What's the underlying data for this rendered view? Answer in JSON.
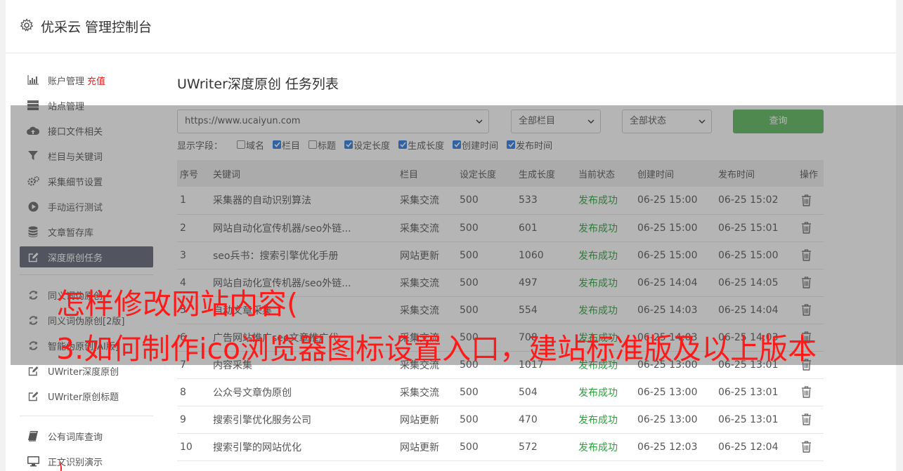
{
  "header": {
    "title": "优采云 管理控制台"
  },
  "sidebar": {
    "recharge": "充值",
    "items": [
      {
        "label": "账户管理",
        "icon": "bar-chart-icon"
      },
      {
        "label": "站点管理",
        "icon": "server-icon"
      },
      {
        "label": "接口文件相关",
        "icon": "cloud-upload-icon"
      },
      {
        "label": "栏目与关键词",
        "icon": "filter-icon"
      },
      {
        "label": "采集细节设置",
        "icon": "gears-icon"
      },
      {
        "label": "手动运行测试",
        "icon": "play-circle-icon"
      },
      {
        "label": "文章暂存库",
        "icon": "database-icon"
      },
      {
        "label": "深度原创任务",
        "icon": "edit-icon"
      },
      {
        "label": "同义词伪原创",
        "icon": "refresh-icon"
      },
      {
        "label": "同义词伪原创[2版]",
        "icon": "refresh-icon"
      },
      {
        "label": "智能伪原创[AI版]",
        "icon": "refresh-icon"
      },
      {
        "label": "UWriter深度原创",
        "icon": "edit-icon"
      },
      {
        "label": "UWriter原创标题",
        "icon": "edit-icon"
      },
      {
        "label": "公有词库查询",
        "icon": "book-icon"
      },
      {
        "label": "正文识别演示",
        "icon": "monitor-icon"
      }
    ]
  },
  "main": {
    "title": "UWriter深度原创 任务列表",
    "site_select": "https://www.ucaiyun.com",
    "column_select": "全部栏目",
    "status_select": "全部状态",
    "query_button": "查询",
    "fields_label": "显示字段：",
    "fields": [
      {
        "label": "域名",
        "checked": false
      },
      {
        "label": "栏目",
        "checked": true
      },
      {
        "label": "标题",
        "checked": false
      },
      {
        "label": "设定长度",
        "checked": true
      },
      {
        "label": "生成长度",
        "checked": true
      },
      {
        "label": "创建时间",
        "checked": true
      },
      {
        "label": "发布时间",
        "checked": true
      }
    ],
    "columns": [
      "序号",
      "关键词",
      "栏目",
      "设定长度",
      "生成长度",
      "当前状态",
      "创建时间",
      "发布时间",
      "操作"
    ],
    "rows": [
      [
        "1",
        "采集器的自动识别算法",
        "采集交流",
        "500",
        "533",
        "发布成功",
        "06-25 15:00",
        "06-25 15:02"
      ],
      [
        "2",
        "网站自动化宣传机器/seo外链...",
        "采集交流",
        "500",
        "601",
        "发布成功",
        "06-25 15:00",
        "06-25 15:01"
      ],
      [
        "3",
        "seo兵书：搜索引擎优化手册",
        "网站更新",
        "500",
        "1060",
        "发布成功",
        "06-25 15:00",
        "06-25 15:00"
      ],
      [
        "4",
        "网站自动化宣传机器/seo外链...",
        "采集交流",
        "500",
        "497",
        "发布成功",
        "06-25 14:04",
        "06-25 14:05"
      ],
      [
        "5",
        "自动文章采集",
        "采集交流",
        "500",
        "554",
        "发布成功",
        "06-25 14:03",
        "06-25 14:04"
      ],
      [
        "6",
        "广告网站推广seo文章推广代",
        "采集交流",
        "500",
        "708",
        "发布成功",
        "06-25 14:03",
        "06-25 14:03"
      ],
      [
        "7",
        "内容采集",
        "采集交流",
        "500",
        "1017",
        "发布成功",
        "06-25 13:00",
        "06-25 13:01"
      ],
      [
        "8",
        "公众号文章伪原创",
        "采集交流",
        "500",
        "504",
        "发布成功",
        "06-25 13:00",
        "06-25 13:01"
      ],
      [
        "9",
        "搜索引擎优化服务公司",
        "网站更新",
        "500",
        "470",
        "发布成功",
        "06-25 13:00",
        "06-25 13:01"
      ],
      [
        "10",
        "搜索引擎的网站优化",
        "网站更新",
        "500",
        "572",
        "发布成功",
        "06-25 12:03",
        "06-25 12:04"
      ]
    ]
  },
  "watermark": {
    "line1": "怎样修改网站内容(",
    "line2": "3.如何制作ico浏览器图标设置入口，建站标准版及以上版本",
    "line3": ")",
    "color": "#ff1a1a"
  },
  "colors": {
    "accent_green": "#5cb85c",
    "status_green": "#2e9e3e",
    "active_sidebar": "#5f6477"
  }
}
